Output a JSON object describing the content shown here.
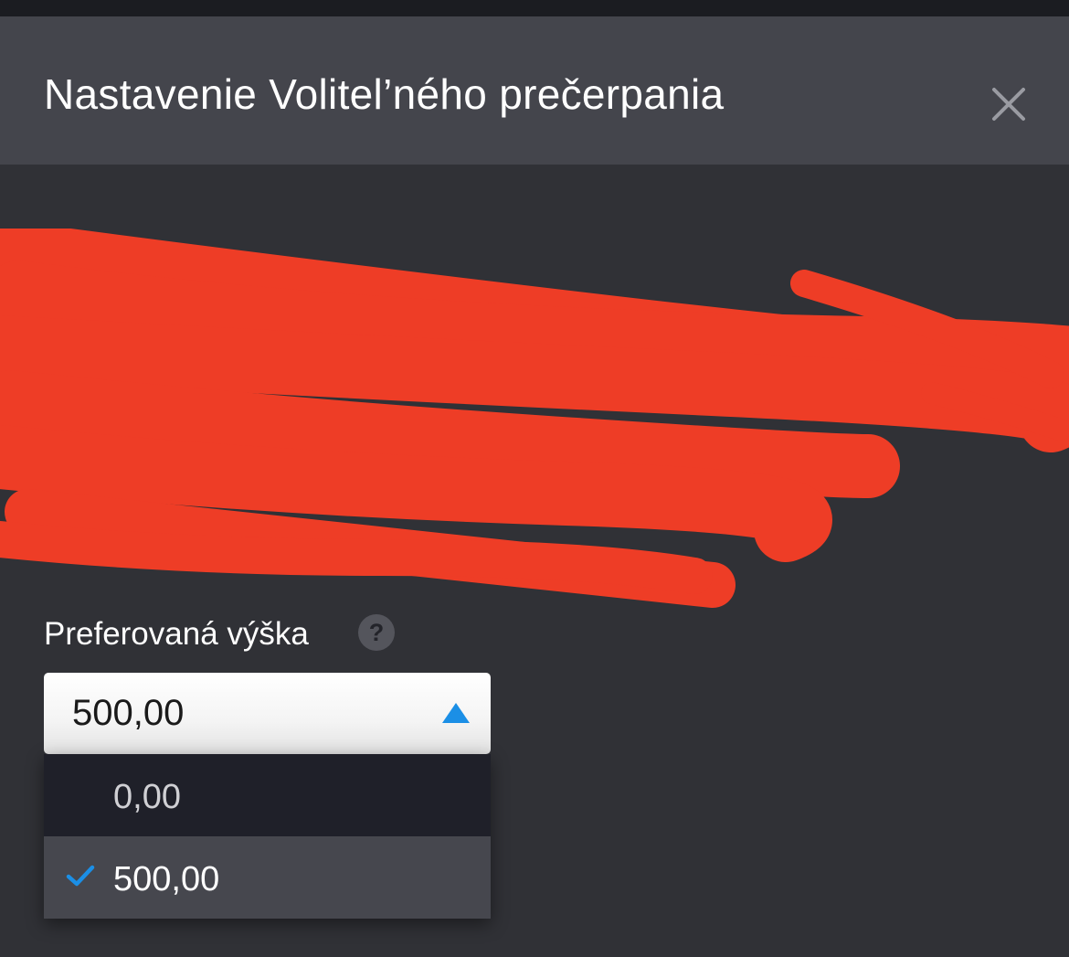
{
  "dialog": {
    "title": "Nastavenie Volitel’ného prečerpania",
    "close_icon": "close-icon",
    "redaction_color": "#ee3d26"
  },
  "field": {
    "label": "Preferovaná výška",
    "help_symbol": "?",
    "selected_value": "500,00",
    "arrow_color": "#1b8fe6"
  },
  "dropdown": {
    "options": [
      {
        "label": "0,00",
        "selected": false
      },
      {
        "label": "500,00",
        "selected": true
      }
    ],
    "check_icon": "checkmark-icon",
    "check_color": "#1b8fe6"
  }
}
